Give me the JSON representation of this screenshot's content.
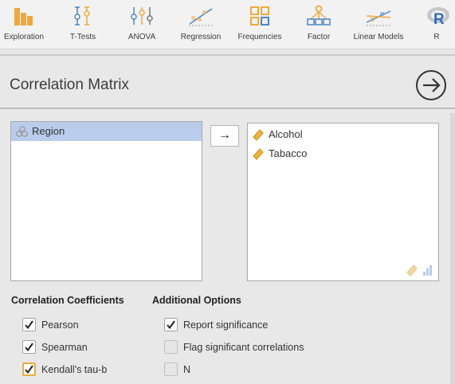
{
  "toolbar": {
    "items": [
      {
        "label": "Exploration",
        "icon": "bar-chart-icon"
      },
      {
        "label": "T-Tests",
        "icon": "ttest-icon"
      },
      {
        "label": "ANOVA",
        "icon": "anova-icon"
      },
      {
        "label": "Regression",
        "icon": "regression-icon"
      },
      {
        "label": "Frequencies",
        "icon": "frequencies-icon"
      },
      {
        "label": "Factor",
        "icon": "factor-icon"
      },
      {
        "label": "Linear Models",
        "icon": "linear-models-icon"
      },
      {
        "label": "R",
        "icon": "r-icon"
      }
    ]
  },
  "analysis": {
    "title": "Correlation Matrix"
  },
  "source_list": {
    "items": [
      {
        "label": "Region",
        "type": "nominal"
      }
    ]
  },
  "move_button": {
    "label": "→"
  },
  "target_list": {
    "items": [
      {
        "label": "Alcohol",
        "type": "continuous"
      },
      {
        "label": "Tabacco",
        "type": "continuous"
      }
    ]
  },
  "coefficients": {
    "heading": "Correlation Coefficients",
    "options": [
      {
        "label": "Pearson",
        "checked": true
      },
      {
        "label": "Spearman",
        "checked": true
      },
      {
        "label": "Kendall's tau-b",
        "checked": true
      }
    ]
  },
  "additional": {
    "heading": "Additional Options",
    "options": [
      {
        "label": "Report significance",
        "checked": true
      },
      {
        "label": "Flag significant correlations",
        "checked": false
      },
      {
        "label": "N",
        "checked": false
      }
    ]
  },
  "colors": {
    "accent": "#f0a83c",
    "icon_orange": "#f0a83c",
    "icon_blue": "#4a86c7",
    "selection": "#b9ccec"
  }
}
